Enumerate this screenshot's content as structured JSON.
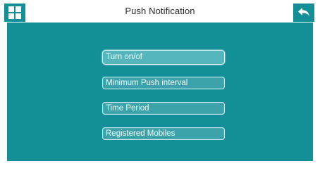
{
  "header": {
    "title": "Push Notification",
    "menu_icon": "grid-icon",
    "back_icon": "back-arrow-icon"
  },
  "menu": {
    "items": [
      {
        "label": "Turn on/of",
        "active": true
      },
      {
        "label": "Minimum Push interval",
        "active": false
      },
      {
        "label": "Time Period",
        "active": false
      },
      {
        "label": "Registered Mobiles",
        "active": false
      }
    ]
  },
  "colors": {
    "accent": "#138f98",
    "highlight": "#55b6bd",
    "text_light": "#f2fbfc"
  }
}
